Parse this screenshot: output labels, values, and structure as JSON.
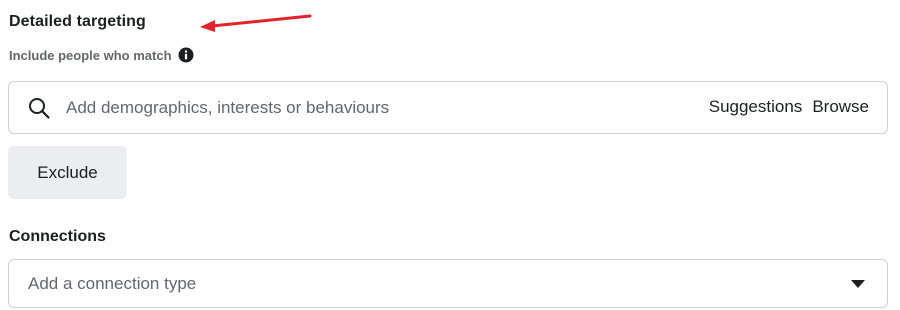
{
  "detailed_targeting": {
    "title": "Detailed targeting",
    "subtitle": "Include people who match",
    "info_icon": "info-circle-icon",
    "search": {
      "icon": "search-icon",
      "placeholder": "Add demographics, interests or behaviours",
      "value": "",
      "suggestions_label": "Suggestions",
      "browse_label": "Browse"
    },
    "exclude_label": "Exclude"
  },
  "connections": {
    "title": "Connections",
    "placeholder": "Add a connection type",
    "dropdown_icon": "caret-down-icon"
  },
  "annotation": {
    "arrow_color": "#e0242b"
  }
}
